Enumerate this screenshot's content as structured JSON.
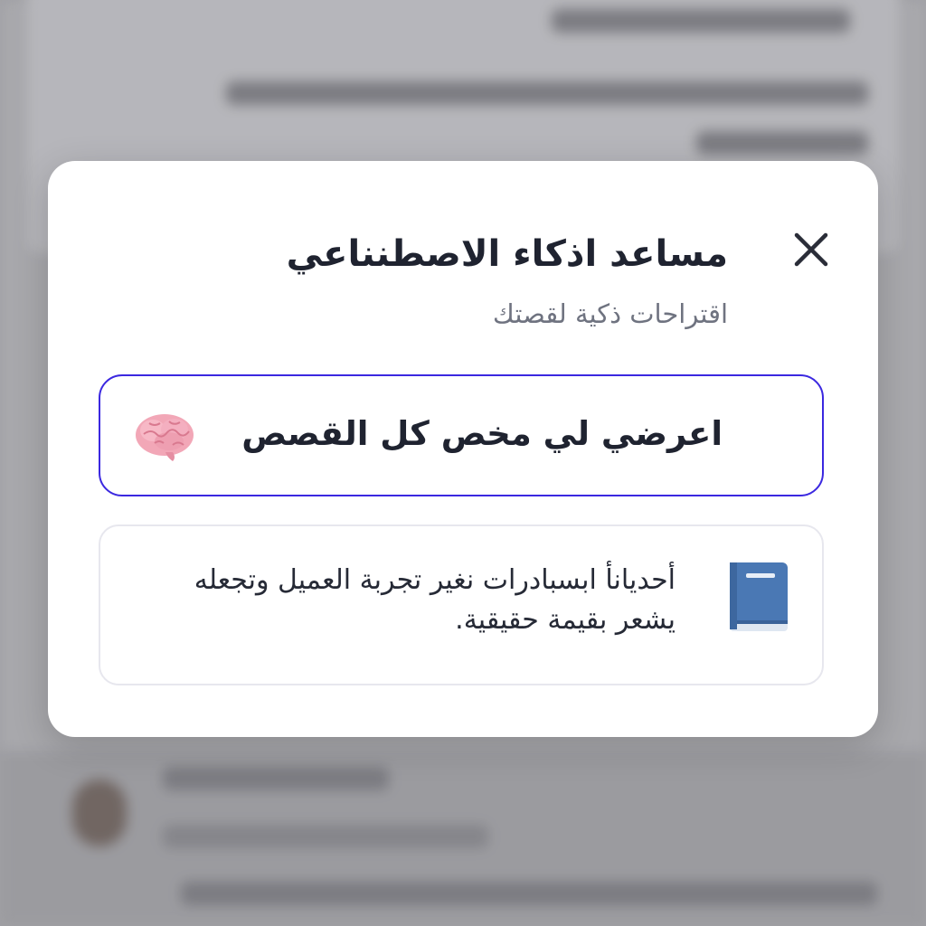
{
  "modal": {
    "title": "مساعد اذكاء الاصطنناعي",
    "subtitle": "اقتراحات ذكية لقصتك",
    "close_icon": "close-icon"
  },
  "options": [
    {
      "label": "اعرضي لي مخص كل القصص",
      "icon": "brain-icon",
      "selected": true
    },
    {
      "text": "أحديانأ ابسبادرات نغير تجربة العميل وتجعله يشعر بقيمة حقيقية.",
      "icon": "book-icon",
      "selected": false
    }
  ],
  "colors": {
    "accent": "#3b28e0",
    "title": "#1f2330",
    "subtitle": "#6f7380",
    "backdrop": "#a9a9ad"
  }
}
